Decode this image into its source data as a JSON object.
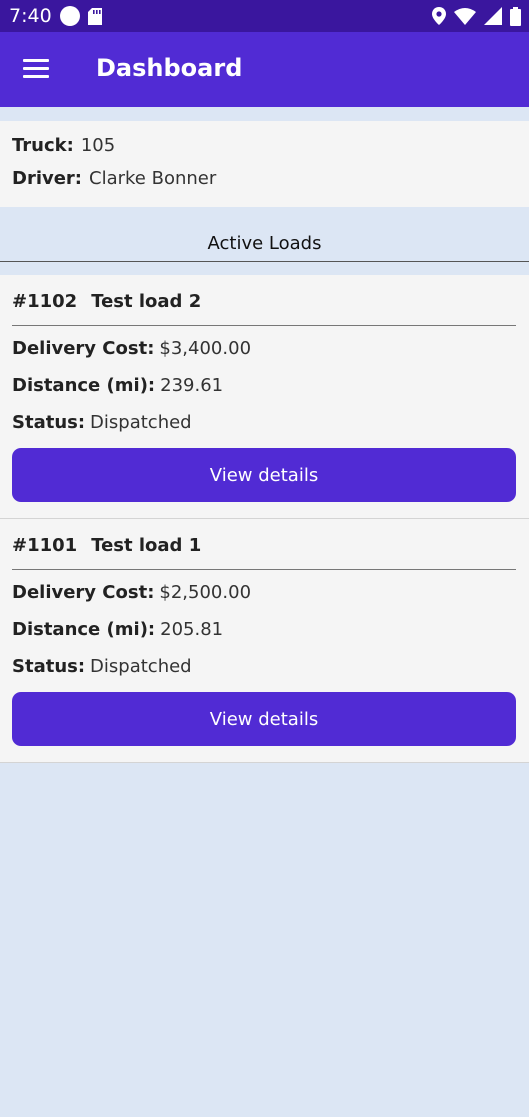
{
  "status_bar": {
    "time": "7:40",
    "icons_left": [
      "circle-icon",
      "sd-card-icon"
    ],
    "icons_right": [
      "location-icon",
      "wifi-icon",
      "signal-icon",
      "battery-icon"
    ]
  },
  "app_bar": {
    "title": "Dashboard",
    "menu_icon": "hamburger-menu-icon"
  },
  "truck_info": {
    "truck_label": "Truck:",
    "truck_value": "105",
    "driver_label": "Driver:",
    "driver_value": "Clarke Bonner"
  },
  "section": {
    "title": "Active Loads"
  },
  "labels": {
    "delivery_cost": "Delivery Cost:",
    "distance": "Distance (mi):",
    "status": "Status:",
    "view_details": "View details"
  },
  "loads": [
    {
      "number": "#1102",
      "name": "Test load 2",
      "delivery_cost": "$3,400.00",
      "distance": "239.61",
      "status": "Dispatched"
    },
    {
      "number": "#1101",
      "name": "Test load 1",
      "delivery_cost": "$2,500.00",
      "distance": "205.81",
      "status": "Dispatched"
    }
  ],
  "colors": {
    "status_bar": "#3a169e",
    "primary": "#512bd4",
    "background": "#dce6f4",
    "card": "#f5f5f5"
  }
}
